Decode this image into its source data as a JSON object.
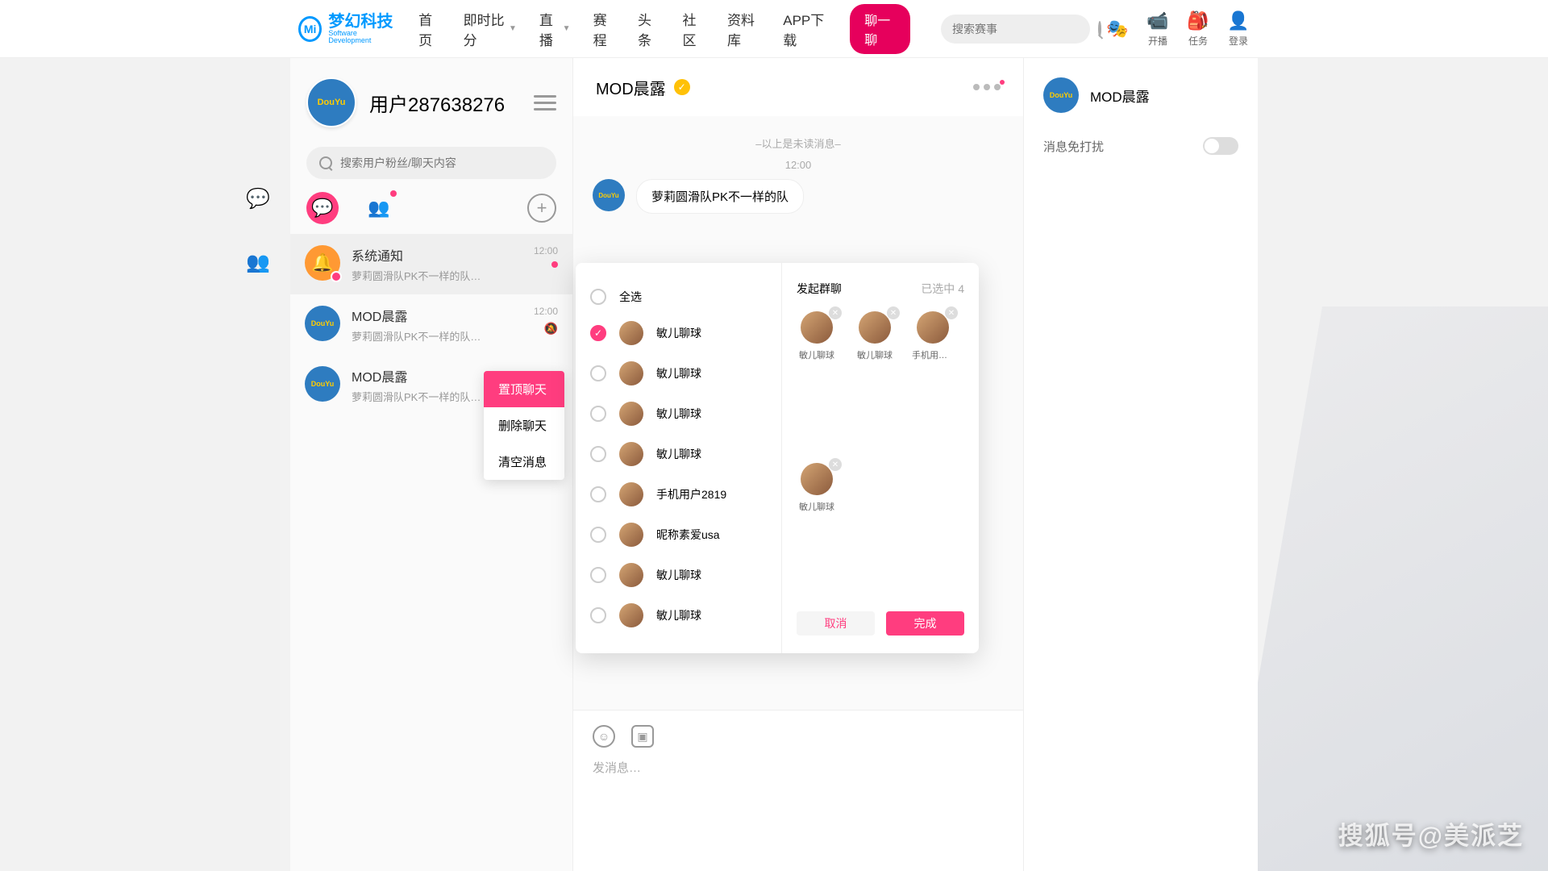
{
  "logo": {
    "cn": "梦幻科技",
    "en": "Software Development",
    "badge": "Mi"
  },
  "nav": {
    "items": [
      "首页",
      "即时比分",
      "直播",
      "赛程",
      "头条",
      "社区",
      "资料库",
      "APP下载"
    ],
    "drops": [
      false,
      true,
      true,
      false,
      false,
      false,
      false,
      false
    ],
    "chat": "聊一聊"
  },
  "search": {
    "placeholder": "搜索赛事"
  },
  "topRight": [
    {
      "icon": "🎭",
      "label": "",
      "class": "pink"
    },
    {
      "icon": "📹",
      "label": "开播"
    },
    {
      "icon": "🎒",
      "label": "任务"
    },
    {
      "icon": "👤",
      "label": "登录"
    }
  ],
  "contacts": {
    "username": "用户287638276",
    "search_ph": "搜索用户粉丝/聊天内容",
    "list": [
      {
        "name": "系统通知",
        "prev": "萝莉圆滑队PK不一样的队…",
        "time": "12:00",
        "notice": true,
        "unread": true,
        "sel": true
      },
      {
        "name": "MOD晨露",
        "prev": "萝莉圆滑队PK不一样的队…",
        "time": "12:00",
        "mute": true
      },
      {
        "name": "MOD晨露",
        "prev": "萝莉圆滑队PK不一样的队…"
      }
    ]
  },
  "ctx": [
    "置顶聊天",
    "删除聊天",
    "清空消息"
  ],
  "chat": {
    "title": "MOD晨露",
    "sys1": "–以上是未读消息–",
    "sys2": "12:00",
    "msg": "萝莉圆滑队PK不一样的队",
    "input_ph": "发消息…"
  },
  "info": {
    "name": "MOD晨露",
    "dnd": "消息免打扰"
  },
  "modal": {
    "select_all": "全选",
    "left_list": [
      {
        "name": "敏儿聊球",
        "on": true
      },
      {
        "name": "敏儿聊球"
      },
      {
        "name": "敏儿聊球"
      },
      {
        "name": "敏儿聊球"
      },
      {
        "name": "手机用户2819"
      },
      {
        "name": "昵称素爱usa"
      },
      {
        "name": "敏儿聊球"
      },
      {
        "name": "敏儿聊球"
      }
    ],
    "title": "发起群聊",
    "count": "已选中 4",
    "selected": [
      "敏儿聊球",
      "敏儿聊球",
      "手机用户...",
      "敏儿聊球"
    ],
    "cancel": "取消",
    "ok": "完成"
  },
  "watermark": "搜狐号@美派芝"
}
